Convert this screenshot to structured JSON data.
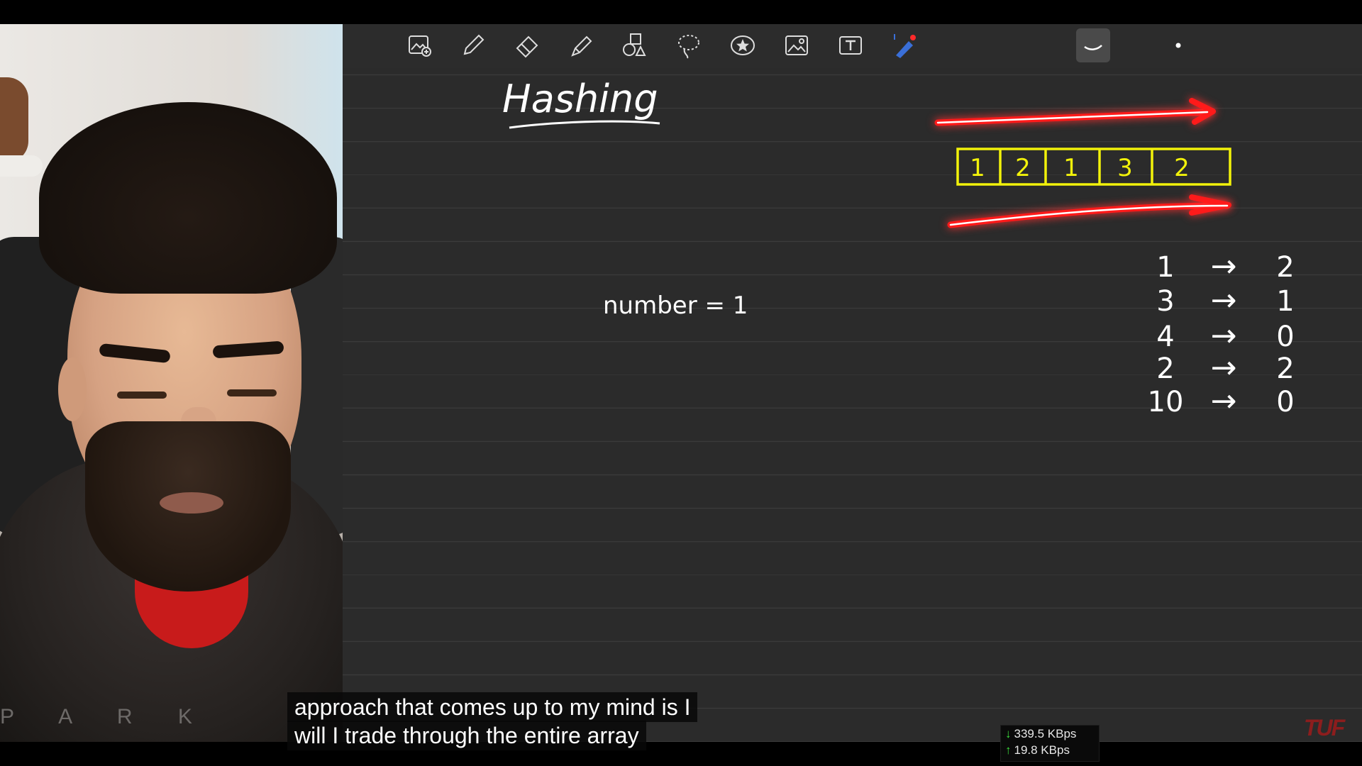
{
  "toolbar": {
    "tools": [
      {
        "name": "zoom-image-tool"
      },
      {
        "name": "pen-tool"
      },
      {
        "name": "eraser-tool"
      },
      {
        "name": "highlighter-tool"
      },
      {
        "name": "shapes-tool"
      },
      {
        "name": "lasso-tool"
      },
      {
        "name": "sticker-tool"
      },
      {
        "name": "image-tool"
      },
      {
        "name": "text-tool"
      },
      {
        "name": "laser-pointer-tool"
      },
      {
        "name": "dot-size"
      },
      {
        "name": "stroke-style"
      }
    ]
  },
  "board": {
    "title": "Hashing",
    "note": "number = 1",
    "array_cells": [
      "1",
      "2",
      "1",
      "3",
      "2"
    ],
    "frequency_table": [
      {
        "key": "1",
        "arrow": "→",
        "count": "2"
      },
      {
        "key": "3",
        "arrow": "→",
        "count": "1"
      },
      {
        "key": "4",
        "arrow": "→",
        "count": "0"
      },
      {
        "key": "2",
        "arrow": "→",
        "count": "2"
      },
      {
        "key": "10",
        "arrow": "→",
        "count": "0"
      }
    ]
  },
  "webcam": {
    "chair_text": "P A R K"
  },
  "subtitles": {
    "line1": "approach that comes up to my mind is I",
    "line2": "will I trade through the entire array"
  },
  "network": {
    "down": "339.5 KBps",
    "up": "19.8 KBps"
  },
  "logo": "TUF",
  "colors": {
    "board_bg": "#2b2b2b",
    "array_yellow": "#f2f20a",
    "arrow_red": "#ff1a1a",
    "ink_white": "#ffffff"
  }
}
